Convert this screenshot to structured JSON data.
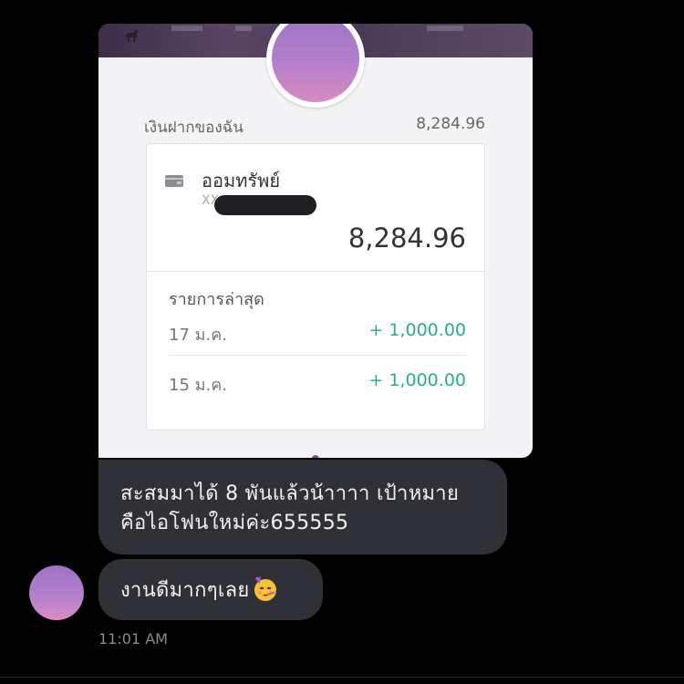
{
  "shared_image": {
    "deposit_label": "เงินฝากของฉัน",
    "deposit_total": "8,284.96",
    "account": {
      "name": "ออมทรัพย์",
      "mask_prefix": "XX",
      "balance": "8,284.96"
    },
    "recent_label": "รายการล่าสุด",
    "transactions": [
      {
        "date": "17 ม.ค.",
        "amount": "+ 1,000.00"
      },
      {
        "date": "15 ม.ค.",
        "amount": "+ 1,000.00"
      }
    ]
  },
  "messages": [
    {
      "lines": [
        "สะสมมาได้ 8 พันแล้วน้าาาา เป้าหมาย",
        "คือไอโฟนใหม่ค่ะ655555"
      ]
    },
    {
      "text": "งานดีมากๆเลย",
      "emoji": "partying-face-icon"
    }
  ],
  "timestamp": "11:01 AM",
  "colors": {
    "background": "#000000",
    "bubble": "#303136",
    "amount_green": "#27b084",
    "avatar_gradient_top": "#9d73c4",
    "avatar_gradient_bottom": "#d78cc3"
  }
}
